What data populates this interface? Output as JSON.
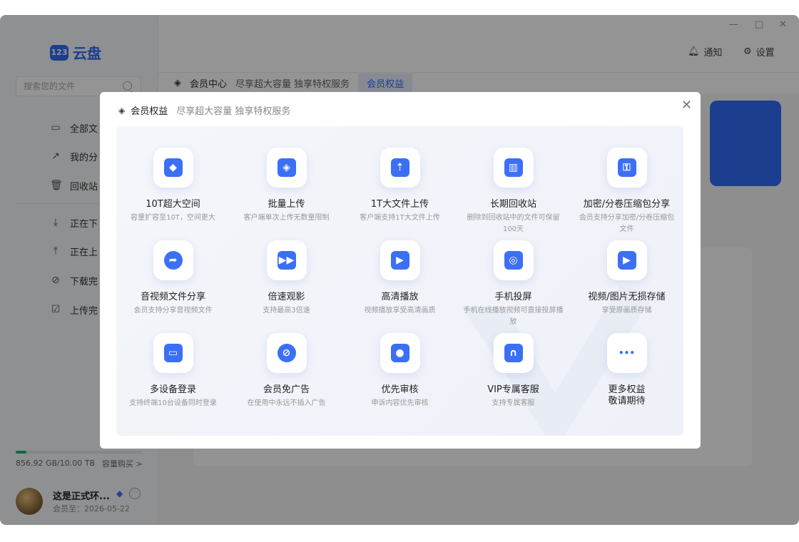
{
  "app": {
    "logo_badge": "123",
    "logo_text": "云盘"
  },
  "sidebar": {
    "search_placeholder": "搜索您的文件",
    "items": [
      {
        "icon": "folder-icon",
        "label": "全部文"
      },
      {
        "icon": "share-icon",
        "label": "我的分"
      },
      {
        "icon": "trash-icon",
        "label": "回收站"
      },
      {
        "icon": "download-icon",
        "label": "正在下"
      },
      {
        "icon": "upload-icon",
        "label": "正在上"
      },
      {
        "icon": "check-circle-icon",
        "label": "下载完"
      },
      {
        "icon": "check-file-icon",
        "label": "上传完"
      }
    ],
    "storage": {
      "used_text": "856.92 GB/10.00 TB",
      "buy_label": "容量购买 >",
      "fill_fraction": 0.086
    },
    "user": {
      "name": "这是正式环...",
      "expire": "会员至：2026-05-22"
    }
  },
  "topbar": {
    "notify_label": "通知",
    "settings_label": "设置",
    "window_controls": [
      "—",
      "□",
      "✕"
    ]
  },
  "tabs": {
    "diamond": "◈",
    "member_center": "会员中心",
    "slogan": "尽享超大容量 独享特权服务",
    "active": "会员权益"
  },
  "modal": {
    "title": "会员权益",
    "subtitle": "尽享超大容量 独享特权服务",
    "close": "✕",
    "benefits": [
      {
        "icon": "cube-icon",
        "glyph": "◆",
        "title": "10T超大空间",
        "desc": "容量扩容至10T，空间更大"
      },
      {
        "icon": "layers-icon",
        "glyph": "◈",
        "title": "批量上传",
        "desc": "客户端单次上传无数量限制"
      },
      {
        "icon": "file-upload-icon",
        "glyph": "⇡",
        "title": "1T大文件上传",
        "desc": "客户端支持1T大文件上传"
      },
      {
        "icon": "recycle-bin-icon",
        "glyph": "▥",
        "title": "长期回收站",
        "desc": "删除到回收站中的文件可保留100天"
      },
      {
        "icon": "lock-icon",
        "glyph": "⚿",
        "title": "加密/分卷压缩包分享",
        "desc": "会员支持分享加密/分卷压缩包文件"
      },
      {
        "icon": "share-arrow-icon",
        "glyph": "➦",
        "title": "音视频文件分享",
        "desc": "会员支持分享音视频文件"
      },
      {
        "icon": "fast-forward-icon",
        "glyph": "▶▶",
        "title": "倍速观影",
        "desc": "支持最高3倍速"
      },
      {
        "icon": "film-icon",
        "glyph": "▶",
        "title": "高清播放",
        "desc": "视频播放享受高清画质"
      },
      {
        "icon": "cast-icon",
        "glyph": "◎",
        "title": "手机投屏",
        "desc": "手机在线播放视频可直接投屏播放"
      },
      {
        "icon": "image-video-icon",
        "glyph": "▶",
        "title": "视频/图片无损存储",
        "desc": "享受原画质存储"
      },
      {
        "icon": "devices-icon",
        "glyph": "▭",
        "title": "多设备登录",
        "desc": "支持终端10台设备同时登录"
      },
      {
        "icon": "no-ads-icon",
        "glyph": "⊘",
        "title": "会员免广告",
        "desc": "在使用中永远不插入广告"
      },
      {
        "icon": "user-icon",
        "glyph": "●",
        "title": "优先审核",
        "desc": "申诉内容优先审核"
      },
      {
        "icon": "headset-icon",
        "glyph": "∩",
        "title": "VIP专属客服",
        "desc": "支持专属客服"
      },
      {
        "icon": "more-dots-icon",
        "glyph": "•••",
        "title": "更多权益\n敬请期待",
        "desc": ""
      }
    ]
  },
  "colors": {
    "accent": "#2f6cf6",
    "storage": "#22b573"
  }
}
